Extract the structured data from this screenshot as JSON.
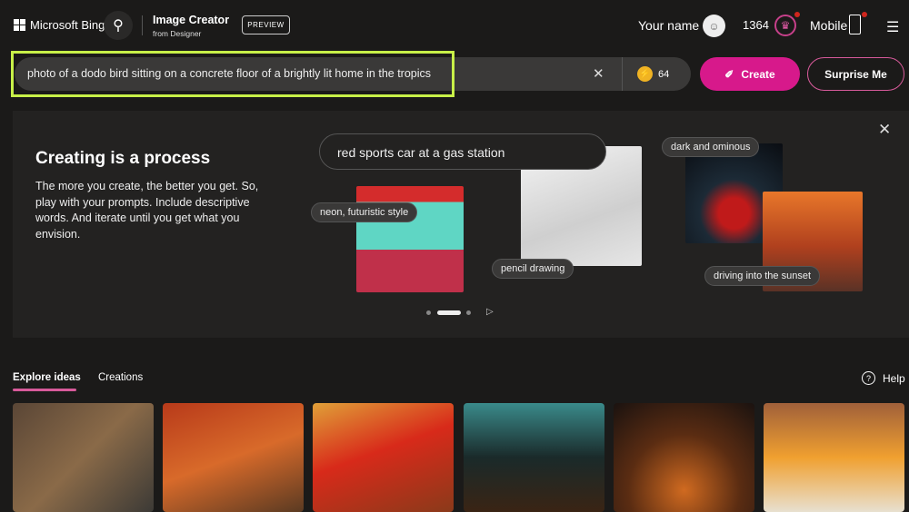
{
  "header": {
    "brand": "Microsoft Bing",
    "title": "Image Creator",
    "subtitle": "from Designer",
    "badge": "PREVIEW",
    "user_name": "Your name",
    "points": "1364",
    "mobile": "Mobile"
  },
  "search": {
    "value": "photo of a dodo bird sitting on a concrete floor of a brightly lit home in the tropics",
    "boosts": "64",
    "create_label": "Create",
    "surprise_label": "Surprise Me"
  },
  "promo": {
    "heading": "Creating is a process",
    "description": "The more you create, the better you get. So, play with your prompts. Include descriptive words. And iterate until you get what you envision.",
    "prompt": "red sports car at a gas station",
    "chips": [
      "neon, futuristic style",
      "pencil drawing",
      "dark and ominous",
      "driving into the sunset"
    ]
  },
  "tabs": [
    {
      "label": "Explore ideas"
    },
    {
      "label": "Creations"
    }
  ],
  "help_label": "Help",
  "colors": {
    "accent": "#d7198b",
    "highlight": "#c8f048"
  }
}
